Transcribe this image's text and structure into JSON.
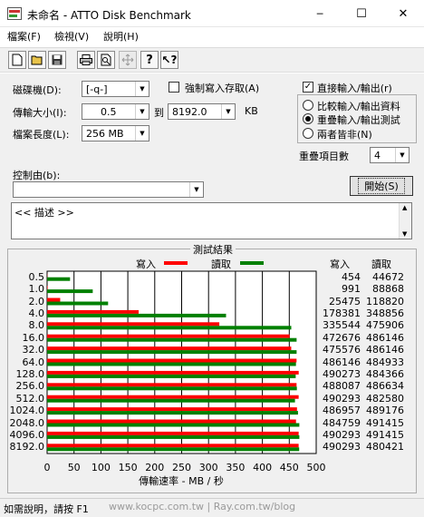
{
  "window": {
    "title": "未命名 - ATTO Disk Benchmark",
    "minimize_glyph": "─",
    "maximize_glyph": "☐",
    "close_glyph": "✕"
  },
  "menu": [
    "檔案(F)",
    "檢視(V)",
    "說明(H)"
  ],
  "toolbar": {
    "buttons": [
      "new-icon",
      "open-icon",
      "save-icon",
      "print-icon",
      "print-preview-icon",
      "move-icon",
      "help-icon",
      "context-help-icon"
    ]
  },
  "settings": {
    "drive_label": "磁碟機(D):",
    "drive_value": "[-q-]",
    "transfer_label": "傳輸大小(I):",
    "transfer_from": "0.5",
    "transfer_to_label": "到",
    "transfer_to": "8192.0",
    "transfer_unit": "KB",
    "length_label": "檔案長度(L):",
    "length_value": "256 MB",
    "force_write_label": "強制寫入存取(A)",
    "force_write_checked": false,
    "direct_io_label": "直接輸入/輸出(r)",
    "direct_io_checked": true,
    "radio_options": [
      "比較輸入/輸出資料",
      "重疊輸入/輸出測試",
      "兩者皆非(N)"
    ],
    "radio_selected": 1,
    "queue_label": "重疊項目數",
    "queue_value": "4",
    "control_label": "控制由(b):",
    "control_value": "",
    "start_button": "開始(S)",
    "description": "<< 描述 >>"
  },
  "results": {
    "title": "測試結果",
    "write_legend": "寫入",
    "read_legend": "讀取",
    "write_header": "寫入",
    "read_header": "讀取"
  },
  "chart_data": {
    "type": "bar",
    "orientation": "horizontal",
    "title": "測試結果",
    "xlabel": "傳輸速率 - MB / 秒",
    "xlim": [
      0,
      500
    ],
    "xticks": [
      0,
      50,
      100,
      150,
      200,
      250,
      300,
      350,
      400,
      450,
      500
    ],
    "categories": [
      "0.5",
      "1.0",
      "2.0",
      "4.0",
      "8.0",
      "16.0",
      "32.0",
      "64.0",
      "128.0",
      "256.0",
      "512.0",
      "1024.0",
      "2048.0",
      "4096.0",
      "8192.0"
    ],
    "series": [
      {
        "name": "寫入",
        "color": "#ff0000",
        "values": [
          0.4,
          1.0,
          24.3,
          170.1,
          320.0,
          450.7,
          453.6,
          463.5,
          467.5,
          463.5,
          467.4,
          464.3,
          462.5,
          467.4,
          467.4
        ],
        "labels": [
          "454",
          "991",
          "25475",
          "178381",
          "335544",
          "472676",
          "475576",
          "486146",
          "490273",
          "488087",
          "490293",
          "486957",
          "484759",
          "490293",
          "490293"
        ]
      },
      {
        "name": "讀取",
        "color": "#008000",
        "values": [
          42.6,
          84.8,
          113.3,
          332.5,
          453.7,
          463.6,
          463.6,
          462.4,
          461.9,
          464.1,
          460.6,
          466.2,
          468.7,
          468.7,
          468.4
        ],
        "labels": [
          "44672",
          "88868",
          "118820",
          "348856",
          "475906",
          "486146",
          "486146",
          "484933",
          "484366",
          "486634",
          "482580",
          "489176",
          "491415",
          "491415",
          "480421"
        ]
      }
    ],
    "grid": true
  },
  "status": {
    "text": "如需說明，請按 F1"
  },
  "watermark": "www.kocpc.com.tw | Ray.com.tw/blog"
}
